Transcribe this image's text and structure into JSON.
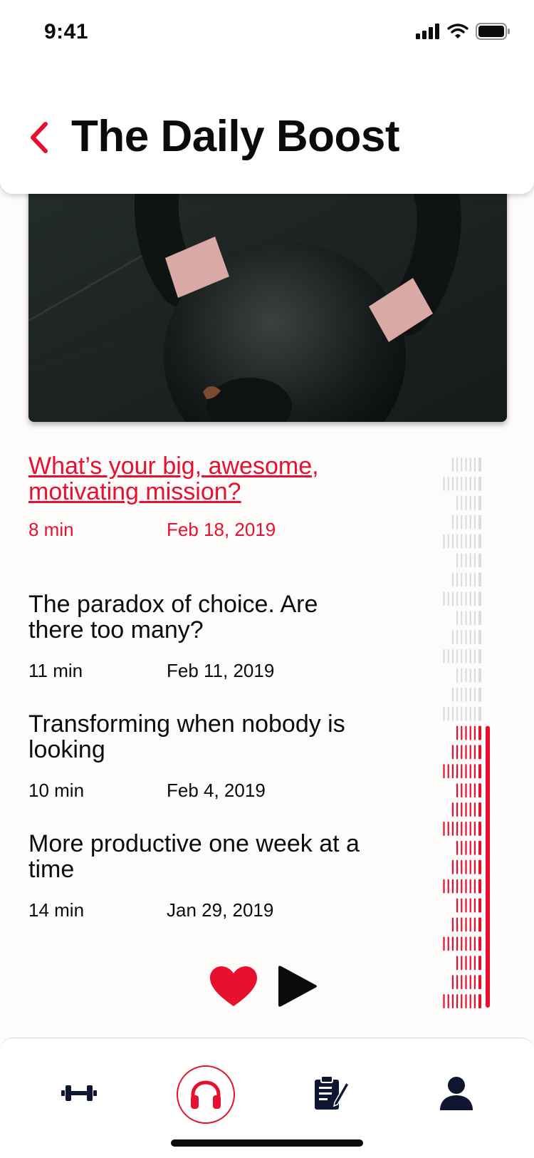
{
  "status_bar": {
    "time": "9:41"
  },
  "header": {
    "title": "The Daily Boost"
  },
  "episodes": [
    {
      "title": "What’s your big, awesome, motivating mission?",
      "duration": "8 min",
      "date": "Feb 18, 2019",
      "active": true
    },
    {
      "title": "The paradox of choice. Are there too many?",
      "duration": "11 min",
      "date": "Feb 11, 2019",
      "active": false
    },
    {
      "title": "Transforming when nobody is looking",
      "duration": "10 min",
      "date": "Feb 4, 2019",
      "active": false
    },
    {
      "title": "More productive one week at a time",
      "duration": "14 min",
      "date": "Jan 29, 2019",
      "active": false
    }
  ],
  "waveform": {
    "progress": 0.47,
    "played_color": "#e8102f",
    "unplayed_color": "#dcdcdc"
  },
  "controls": {
    "liked": true
  },
  "colors": {
    "accent": "#e8102f",
    "text": "#0b0b0b",
    "nav_icon": "#0f1630"
  },
  "tabbar": {
    "items": [
      {
        "icon": "dumbbell-icon",
        "active": false
      },
      {
        "icon": "headphones-icon",
        "active": true
      },
      {
        "icon": "clipboard-icon",
        "active": false
      },
      {
        "icon": "user-icon",
        "active": false
      }
    ]
  }
}
